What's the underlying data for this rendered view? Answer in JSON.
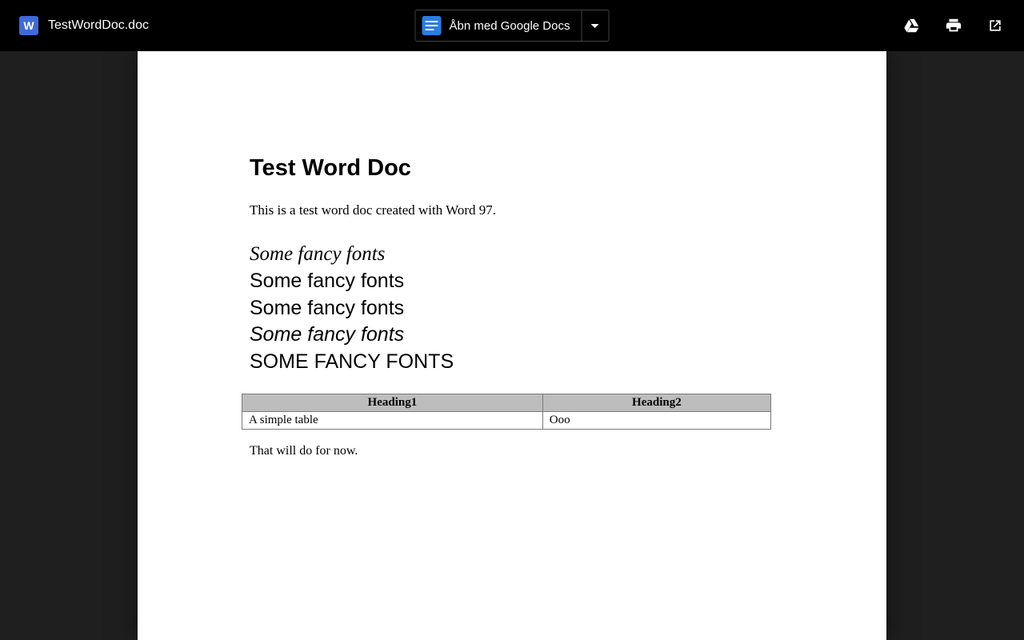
{
  "header": {
    "file_badge_letter": "W",
    "file_name": "TestWordDoc.doc",
    "open_with_label": "Åbn med Google Docs"
  },
  "document": {
    "title": "Test Word Doc",
    "intro": "This is a test word doc created with Word 97.",
    "fancy_lines": {
      "l1": "Some fancy fonts",
      "l2": "Some fancy fonts",
      "l3": "Some fancy fonts",
      "l4": "Some fancy fonts",
      "l5": "SOME FANCY FONTS"
    },
    "table": {
      "headers": {
        "h1": "Heading1",
        "h2": "Heading2"
      },
      "row1": {
        "c1": "A simple table",
        "c2": "Ooo"
      }
    },
    "outro": "That will do for now."
  }
}
